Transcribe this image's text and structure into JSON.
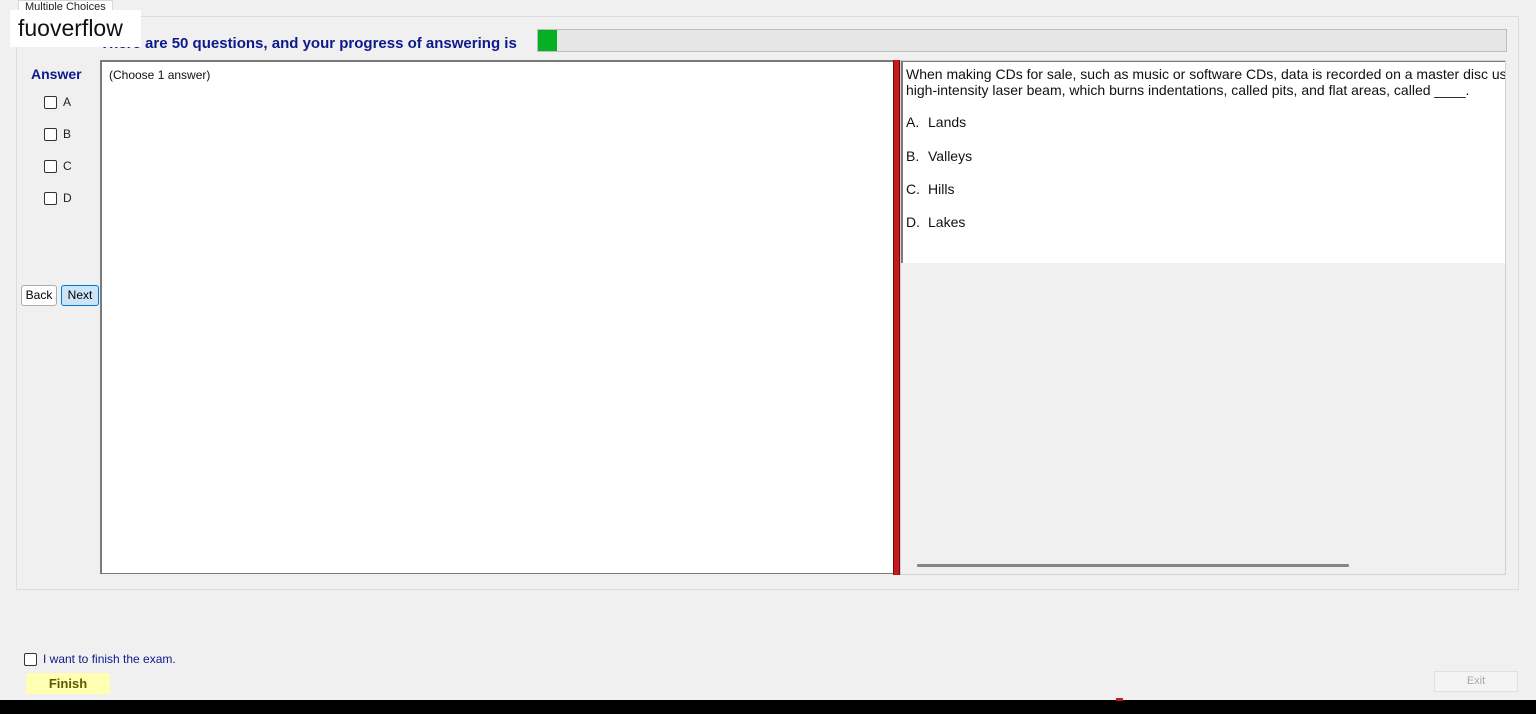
{
  "tab": {
    "label": "Multiple Choices"
  },
  "watermark": {
    "text": "fuoverflow"
  },
  "progress": {
    "text": "There are 50 questions, and your progress of answering is",
    "fraction": 0.02,
    "fill_color": "#06b025"
  },
  "answer_panel": {
    "title": "Answer",
    "options": [
      {
        "label": "A",
        "checked": false
      },
      {
        "label": "B",
        "checked": false
      },
      {
        "label": "C",
        "checked": false
      },
      {
        "label": "D",
        "checked": false
      }
    ],
    "back_label": "Back",
    "next_label": "Next"
  },
  "answer_box": {
    "hint": "(Choose 1 answer)"
  },
  "question": {
    "stem_line1": "When making CDs for sale, such as music or software CDs, data is recorded on a master disc using a",
    "stem_line2": "high-intensity laser beam, which burns indentations, called pits, and flat areas, called ____.",
    "choices": [
      {
        "key": "A.",
        "text": "Lands"
      },
      {
        "key": "B.",
        "text": "Valleys"
      },
      {
        "key": "C.",
        "text": "Hills"
      },
      {
        "key": "D.",
        "text": "Lakes"
      }
    ]
  },
  "footer": {
    "finish_check_label": "I want to finish the exam.",
    "finish_label": "Finish",
    "exit_label": "Exit"
  },
  "colors": {
    "accent_text": "#0c1a8c",
    "splitter": "#c8191f",
    "finish_bg": "#ffffb3"
  }
}
